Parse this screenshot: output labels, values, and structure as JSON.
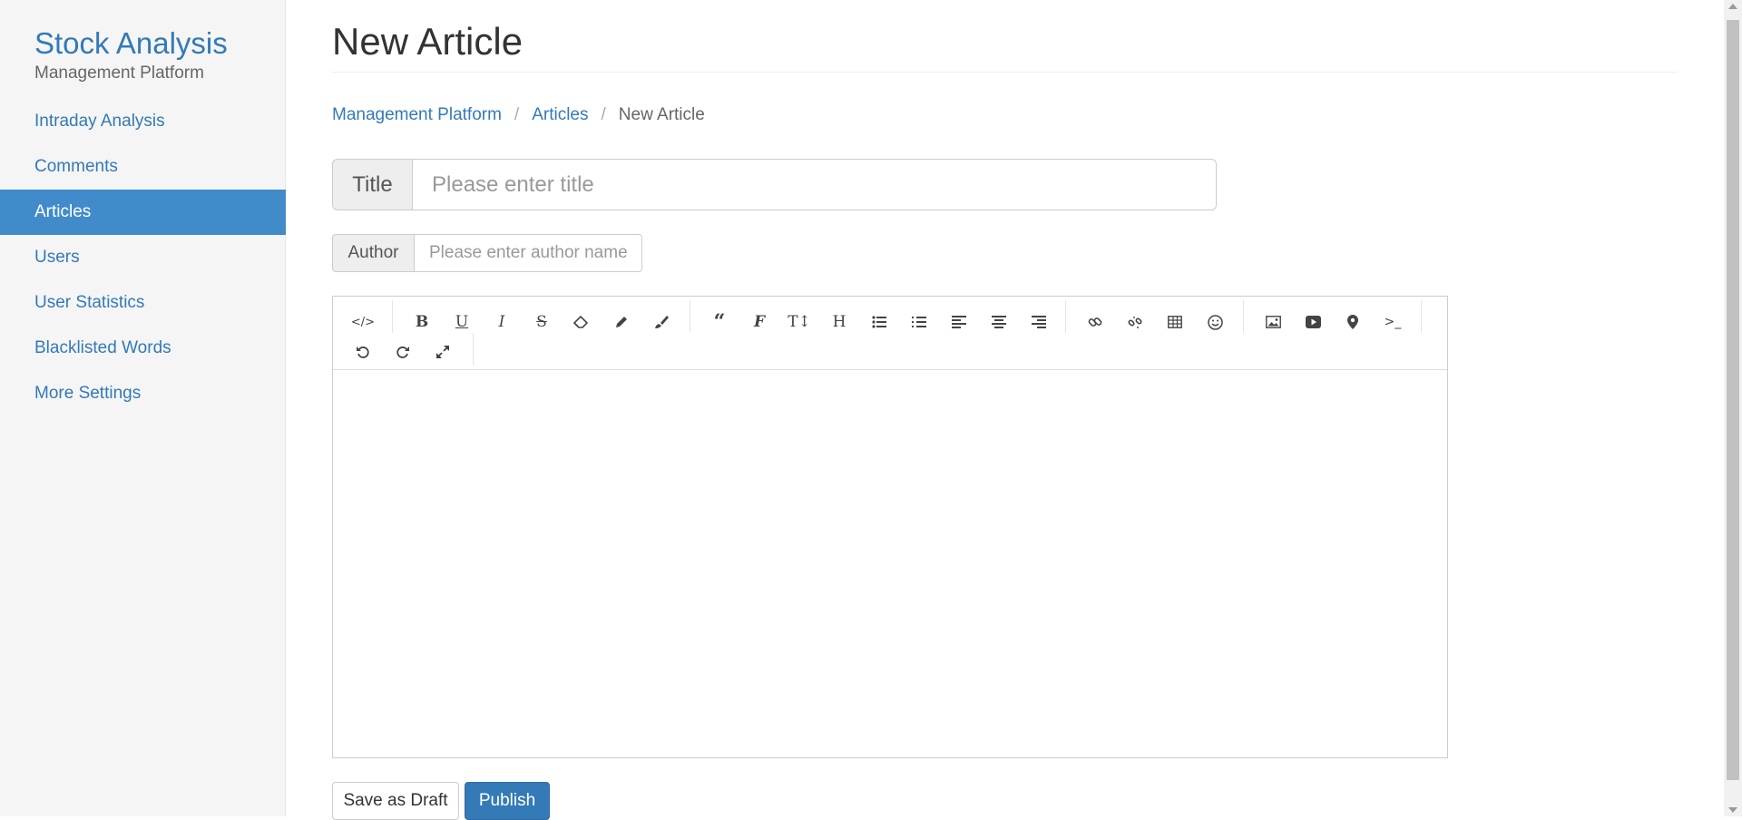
{
  "sidebar": {
    "brand_title": "Stock Analysis",
    "brand_subtitle": "Management Platform",
    "items": [
      {
        "label": "Intraday Analysis",
        "active": false
      },
      {
        "label": "Comments",
        "active": false
      },
      {
        "label": "Articles",
        "active": true
      },
      {
        "label": "Users",
        "active": false
      },
      {
        "label": "User Statistics",
        "active": false
      },
      {
        "label": "Blacklisted Words",
        "active": false
      },
      {
        "label": "More Settings",
        "active": false
      }
    ]
  },
  "page": {
    "title": "New Article",
    "breadcrumb": [
      "Management Platform",
      "Articles",
      "New Article"
    ],
    "breadcrumb_separator": "/"
  },
  "form": {
    "title_label": "Title",
    "title_placeholder": "Please enter title",
    "author_label": "Author",
    "author_placeholder": "Please enter author name"
  },
  "editor": {
    "toolbar_icons": [
      "code-view-icon",
      "bold-icon",
      "underline-icon",
      "italic-icon",
      "strikethrough-icon",
      "eraser-icon",
      "pencil-icon",
      "paintbrush-icon",
      "blockquote-icon",
      "font-family-icon",
      "font-size-icon",
      "heading-icon",
      "bullet-list-icon",
      "numbered-list-icon",
      "align-left-icon",
      "align-center-icon",
      "align-right-icon",
      "link-icon",
      "unlink-icon",
      "table-icon",
      "emoji-icon",
      "image-icon",
      "video-icon",
      "map-marker-icon",
      "terminal-icon",
      "undo-icon",
      "redo-icon",
      "fullscreen-icon"
    ]
  },
  "actions": {
    "save_draft": "Save as Draft",
    "publish": "Publish"
  },
  "colors": {
    "accent": "#337ab7",
    "active_nav": "#428bca",
    "sidebar_bg": "#f5f5f5"
  }
}
